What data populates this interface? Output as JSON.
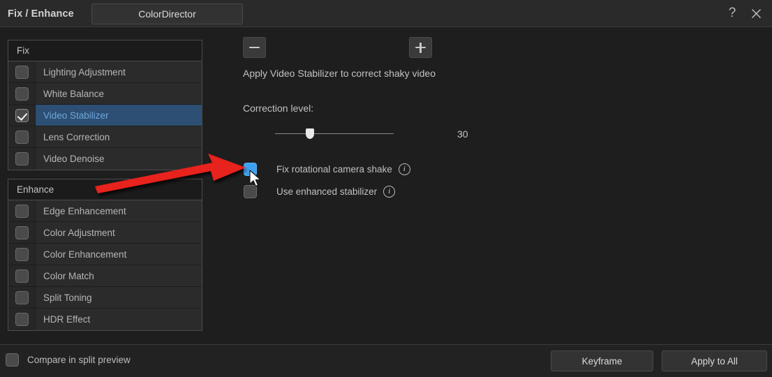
{
  "window": {
    "title": "Fix / Enhance",
    "tab_label": "ColorDirector",
    "help_icon": "question-mark-icon",
    "close_icon": "close-x-icon"
  },
  "sidebar": {
    "groups": [
      {
        "header": "Fix",
        "items": [
          {
            "label": "Lighting Adjustment",
            "checked": false,
            "selected": false
          },
          {
            "label": "White Balance",
            "checked": false,
            "selected": false
          },
          {
            "label": "Video Stabilizer",
            "checked": true,
            "selected": true
          },
          {
            "label": "Lens Correction",
            "checked": false,
            "selected": false
          },
          {
            "label": "Video Denoise",
            "checked": false,
            "selected": false
          }
        ]
      },
      {
        "header": "Enhance",
        "items": [
          {
            "label": "Edge Enhancement",
            "checked": false,
            "selected": false
          },
          {
            "label": "Color Adjustment",
            "checked": false,
            "selected": false
          },
          {
            "label": "Color Enhancement",
            "checked": false,
            "selected": false
          },
          {
            "label": "Color Match",
            "checked": false,
            "selected": false
          },
          {
            "label": "Split Toning",
            "checked": false,
            "selected": false
          },
          {
            "label": "HDR Effect",
            "checked": false,
            "selected": false
          }
        ]
      }
    ]
  },
  "main": {
    "description": "Apply Video Stabilizer to correct shaky video",
    "correction_label": "Correction level:",
    "slider": {
      "value": "30",
      "minus_icon": "minus-icon",
      "plus_icon": "plus-icon",
      "percent": 26
    },
    "options": [
      {
        "label": "Fix rotational camera shake",
        "checked": true,
        "highlighted": true,
        "info_icon": "info-icon"
      },
      {
        "label": "Use enhanced stabilizer",
        "checked": false,
        "highlighted": false,
        "info_icon": "info-icon"
      }
    ]
  },
  "footer": {
    "compare_label": "Compare in split preview",
    "compare_checked": false,
    "keyframe_label": "Keyframe",
    "apply_all_label": "Apply to All"
  },
  "annotation": {
    "arrow_color": "#e8201c",
    "cursor_icon": "mouse-pointer-icon"
  },
  "colors": {
    "background": "#1e1e1e",
    "panel": "#2b2b2b",
    "selected_row": "#2c4f73",
    "selected_text": "#6fa8dc",
    "checkbox_blue": "#3ea0f0"
  }
}
